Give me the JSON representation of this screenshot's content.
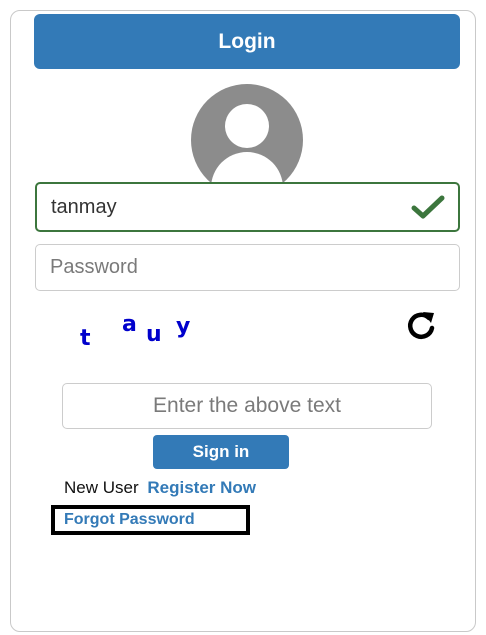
{
  "login": {
    "title": "Login",
    "username_value": "tanmay",
    "password_placeholder": "Password",
    "captcha_chars": [
      "t",
      "a",
      "u",
      "y"
    ],
    "captcha_input_placeholder": "Enter the above text",
    "signin_label": "Sign in",
    "new_user_text": "New User",
    "register_label": "Register Now",
    "forgot_label": "Forgot Password"
  },
  "icons": {
    "avatar": "user-avatar-icon",
    "check": "check-icon",
    "refresh": "refresh-icon"
  },
  "colors": {
    "primary": "#337ab7",
    "valid_border": "#3c763d",
    "check": "#3c763d",
    "captcha_text": "#0000cc"
  }
}
